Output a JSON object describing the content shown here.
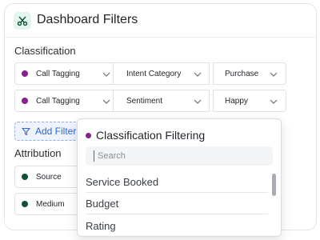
{
  "header": {
    "title": "Dashboard Filters",
    "icon": "scissors-icon"
  },
  "classification": {
    "title": "Classification",
    "rows": [
      {
        "dot_color": "#8a1f8e",
        "field": "Call Tagging",
        "category": "Intent Category",
        "value": "Purchase"
      },
      {
        "dot_color": "#8a1f8e",
        "field": "Call Tagging",
        "category": "Sentiment",
        "value": "Happy"
      }
    ]
  },
  "add_filter": {
    "label": "Add Filter",
    "icon": "filter-icon"
  },
  "attribution": {
    "title": "Attribution",
    "rows": [
      {
        "dot_color": "#0f5135",
        "field": "Source"
      },
      {
        "dot_color": "#0f5135",
        "field": "Medium"
      }
    ]
  },
  "dropdown": {
    "title": "Classification Filtering",
    "dot_color": "#8a1f8e",
    "search_placeholder": "Search",
    "items": [
      "Service Booked",
      "Budget",
      "Rating"
    ]
  },
  "colors": {
    "accent_blue": "#2f66d6",
    "header_icon_bg": "#e3f5ee",
    "header_icon_fg": "#0f5135"
  }
}
